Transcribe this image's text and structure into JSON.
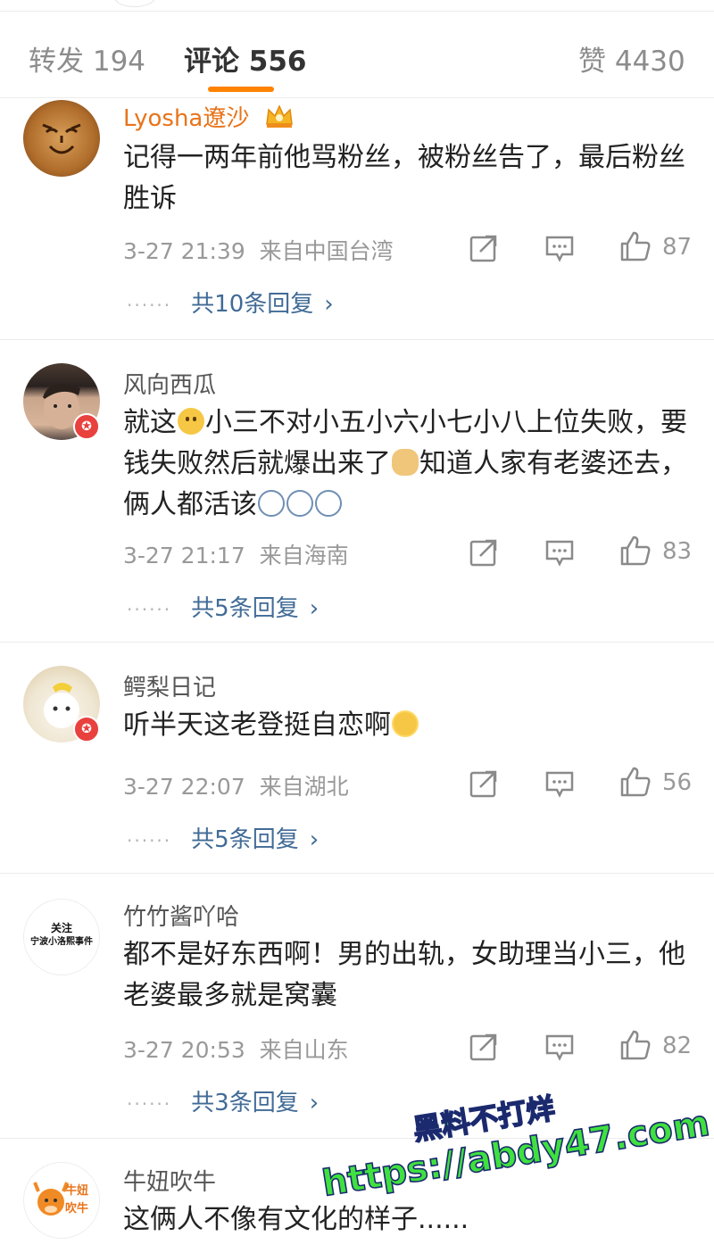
{
  "tabs": [
    {
      "label": "转发 194"
    },
    {
      "label": "评论 556"
    },
    {
      "label": "赞 4430"
    }
  ],
  "comments": [
    {
      "username": "Lyosha遼沙",
      "text_parts": [
        "记得一两年前他骂粉丝，被粉丝告了，最后粉丝胜诉"
      ],
      "time": "3-27 21:39",
      "location": "来自中国台湾",
      "likes": "87",
      "replies": "共10条回复"
    },
    {
      "username": "风向西瓜",
      "text_parts": [
        "就这",
        "小三不对小五小六小七小八上位失败，要钱失败然后就爆出来了",
        "知道人家有老婆还去，俩人都活该"
      ],
      "time": "3-27 21:17",
      "location": "来自海南",
      "likes": "83",
      "replies": "共5条回复"
    },
    {
      "username": "鳄梨日记",
      "text_parts": [
        "听半天这老登挺自恋啊"
      ],
      "time": "3-27 22:07",
      "location": "来自湖北",
      "likes": "56",
      "replies": "共5条回复"
    },
    {
      "username": "竹竹酱吖哈",
      "avatar_text": [
        "关注",
        "宁波小洛熙事件"
      ],
      "text_parts": [
        "都不是好东西啊！男的出轨，女助理当小三，他老婆最多就是窝囊"
      ],
      "time": "3-27 20:53",
      "location": "来自山东",
      "likes": "82",
      "replies": "共3条回复"
    },
    {
      "username": "牛妞吹牛",
      "avatar_text": [
        "牛妞",
        "吹牛"
      ],
      "text_parts": [
        "这俩人不像有文化的样子......"
      ]
    }
  ],
  "reply_chevron": "›",
  "badge_glyph": "✪",
  "watermark": {
    "line1": "黑料不打烊",
    "line2": "https://abdy47.com"
  },
  "colors": {
    "accent": "#ff8200",
    "link": "#416b96",
    "vip_name": "#e8741a",
    "watermark": "#3fe03f"
  },
  "icons": [
    "share-icon",
    "comment-icon",
    "like-icon",
    "verified-badge-icon",
    "crown-icon"
  ]
}
